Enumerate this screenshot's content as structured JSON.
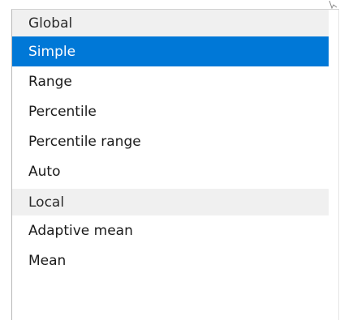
{
  "dropdown": {
    "groups": [
      {
        "header": "Global",
        "items": [
          "Simple",
          "Range",
          "Percentile",
          "Percentile range",
          "Auto"
        ]
      },
      {
        "header": "Local",
        "items": [
          "Adaptive mean",
          "Mean"
        ]
      }
    ],
    "selected": "Simple"
  },
  "colors": {
    "selection_bg": "#0078d7",
    "selection_text": "#ffffff",
    "header_bg": "#f0f0f0",
    "text": "#1a1a1a"
  }
}
